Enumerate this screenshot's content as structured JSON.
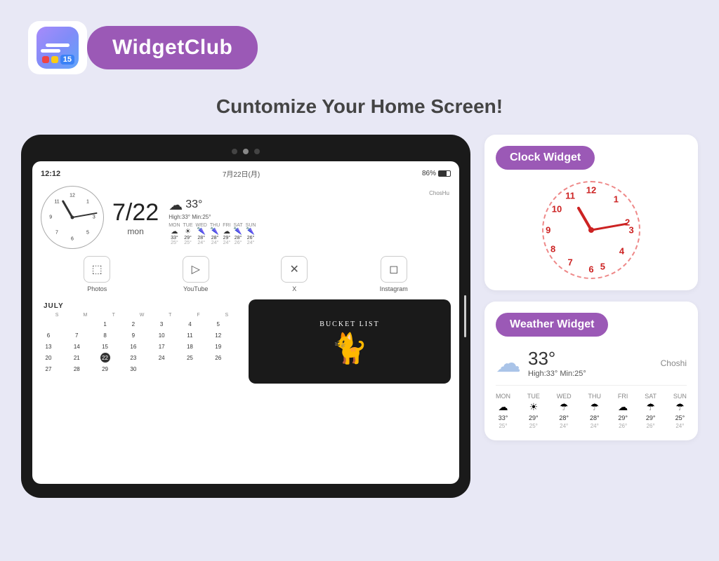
{
  "header": {
    "brand": "WidgetClub",
    "logo_num": "15"
  },
  "tagline": "Cuntomize Your Home Screen!",
  "tablet": {
    "time": "12:12",
    "date_kanji": "7月22日(月)",
    "battery": "86%",
    "date_display": "7/22",
    "day_display": "mon",
    "weather": {
      "location": "ChosHu",
      "temp": "33°",
      "high": "High:33°",
      "low": "Min:25°",
      "days": [
        {
          "name": "MON",
          "icon": "☁",
          "high": "33°",
          "low": "25°"
        },
        {
          "name": "TUE",
          "icon": "☀",
          "high": "29°",
          "low": "25°"
        },
        {
          "name": "WED",
          "icon": "🌂",
          "high": "28°",
          "low": "24°"
        },
        {
          "name": "THU",
          "icon": "🌂",
          "high": "28°",
          "low": "24°"
        },
        {
          "name": "FRI",
          "icon": "☁",
          "high": "29°",
          "low": "24°"
        },
        {
          "name": "SAT",
          "icon": "🌂",
          "high": "28°",
          "low": "26°"
        },
        {
          "name": "SUN",
          "icon": "🌂",
          "high": "26°",
          "low": "24°"
        }
      ]
    },
    "apps": [
      {
        "label": "Photos",
        "icon": "🖼"
      },
      {
        "label": "YouTube",
        "icon": "▶"
      },
      {
        "label": "X",
        "icon": "𝕏"
      },
      {
        "label": "Instagram",
        "icon": "📷"
      }
    ],
    "calendar": {
      "month": "JULY",
      "headers": [
        "S",
        "M",
        "T",
        "W",
        "T",
        "F",
        "S"
      ],
      "days": [
        "",
        "",
        "1",
        "2",
        "3",
        "4",
        "5",
        "6",
        "7",
        "8",
        "9",
        "10",
        "11",
        "12",
        "13",
        "14",
        "15",
        "16",
        "17",
        "18",
        "19",
        "20",
        "21",
        "22",
        "23",
        "24",
        "25",
        "26",
        "27",
        "28",
        "29",
        "30"
      ]
    },
    "bucket": {
      "title": "Bucket List"
    }
  },
  "right_panel": {
    "clock_widget": {
      "title": "Clock Widget",
      "numbers": [
        "12",
        "1",
        "2",
        "3",
        "4",
        "5",
        "6",
        "7",
        "8",
        "9",
        "10",
        "11"
      ]
    },
    "weather_widget": {
      "title": "Weather Widget",
      "temp": "33°",
      "high_low": "High:33° Min:25°",
      "location": "Choshi",
      "days": [
        {
          "name": "MON",
          "icon": "☁",
          "high": "33°",
          "low": "25°"
        },
        {
          "name": "TUE",
          "icon": "☀",
          "high": "29°",
          "low": "25°"
        },
        {
          "name": "WED",
          "icon": "☂",
          "high": "28°",
          "low": "24°"
        },
        {
          "name": "THU",
          "icon": "☂",
          "high": "28°",
          "low": "24°"
        },
        {
          "name": "FRI",
          "icon": "☁",
          "high": "29°",
          "low": "26°"
        },
        {
          "name": "SAT",
          "icon": "☂",
          "high": "29°",
          "low": "26°"
        },
        {
          "name": "SUN",
          "icon": "☂",
          "high": "25°",
          "low": "24°"
        }
      ]
    }
  }
}
